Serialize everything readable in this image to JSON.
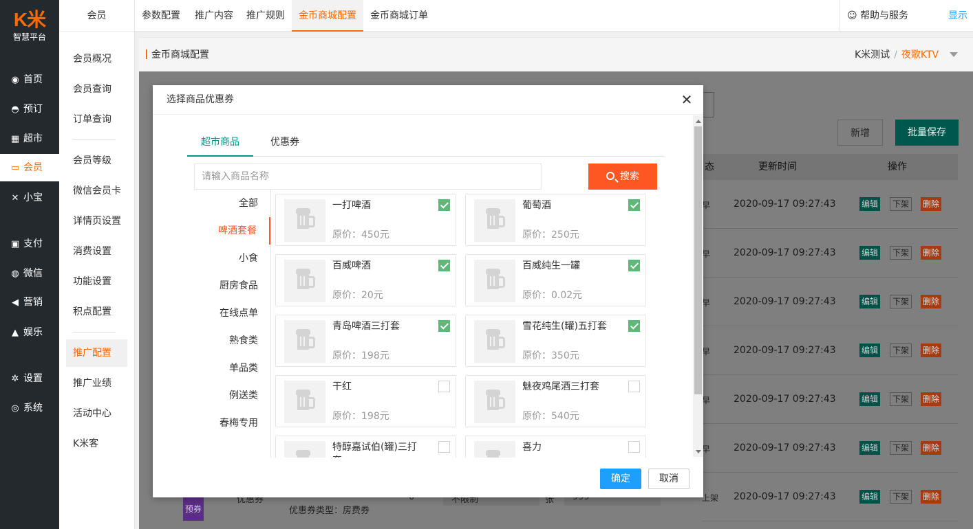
{
  "logo": {
    "mark": "K米",
    "subtitle": "智慧平台"
  },
  "sidebar": {
    "items": [
      {
        "label": "首页",
        "icon": "dashboard-icon",
        "glyph": "◉"
      },
      {
        "label": "预订",
        "icon": "bell-icon",
        "glyph": "◓"
      },
      {
        "label": "超市",
        "icon": "basket-icon",
        "glyph": "▦"
      },
      {
        "label": "会员",
        "icon": "card-icon",
        "glyph": "▭"
      },
      {
        "label": "小宝",
        "icon": "xiaobao-icon",
        "glyph": "✕"
      },
      {
        "label": "支付",
        "icon": "money-icon",
        "glyph": "▣"
      },
      {
        "label": "微信",
        "icon": "wechat-icon",
        "glyph": "◍"
      },
      {
        "label": "营销",
        "icon": "megaphone-icon",
        "glyph": "◀"
      },
      {
        "label": "娱乐",
        "icon": "lock-icon",
        "glyph": "▲"
      },
      {
        "label": "设置",
        "icon": "gears-icon",
        "glyph": "✲"
      },
      {
        "label": "系统",
        "icon": "compass-icon",
        "glyph": "◎"
      }
    ]
  },
  "subnav": {
    "header": "会员",
    "items": [
      "会员概况",
      "会员查询",
      "订单查询",
      "会员等级",
      "微信会员卡",
      "详情页设置",
      "消费设置",
      "功能设置",
      "积点配置",
      "推广配置",
      "推广业绩",
      "活动中心",
      "K米客"
    ]
  },
  "topbar": {
    "tabs": [
      "参数配置",
      "推广内容",
      "推广规则",
      "金币商城配置",
      "金币商城订单"
    ],
    "help": "帮助与服务",
    "show": "显示"
  },
  "breadcrumb": {
    "title": "金币商城配置",
    "store": "K米测试",
    "separator": "/",
    "branch": "夜歌KTV"
  },
  "page": {
    "add_button": "新增",
    "batch_save_button": "批量保存",
    "columns": {
      "status_partial": "态",
      "update_time": "更新时间",
      "actions": "操作"
    },
    "rows": [
      {
        "edge": "早",
        "time": "2020-09-17 09:27:43"
      },
      {
        "edge": "早",
        "time": "2020-09-17 09:27:43"
      },
      {
        "edge": "早",
        "time": "2020-09-17 09:27:43"
      },
      {
        "edge": "早",
        "time": "2020-09-17 09:27:43"
      },
      {
        "edge": "早",
        "time": "2020-09-17 09:27:43"
      },
      {
        "edge": "早",
        "time": "2020-09-17 09:27:43"
      },
      {
        "edge": "上架",
        "time": "2020-09-17 09:27:43"
      }
    ],
    "row_actions": {
      "edit": "编辑",
      "offline": "下架",
      "delete": "删除"
    },
    "under_modal": {
      "badge": "预券",
      "type_cell": "优惠券",
      "coupon_type": "优惠券类型：房费券",
      "count": "0",
      "limit": "不限制",
      "unit": "张",
      "price": "999"
    }
  },
  "modal": {
    "title": "选择商品优惠券",
    "tabs": [
      "超市商品",
      "优惠券"
    ],
    "search_placeholder": "请输入商品名称",
    "search_value": "",
    "search_button": "搜索",
    "categories": [
      "全部",
      "啤酒套餐",
      "小食",
      "厨房食品",
      "在线点单",
      "熟食类",
      "单品类",
      "例送类",
      "春梅专用"
    ],
    "active_category": "啤酒套餐",
    "products": [
      {
        "name": "一打啤酒",
        "price": "原价：450元",
        "checked": true
      },
      {
        "name": "葡萄酒",
        "price": "原价：250元",
        "checked": true
      },
      {
        "name": "百威啤酒",
        "price": "原价：20元",
        "checked": true
      },
      {
        "name": "百威纯生一罐",
        "price": "原价：0.02元",
        "checked": true
      },
      {
        "name": "青岛啤酒三打套",
        "price": "原价：198元",
        "checked": true
      },
      {
        "name": "雪花纯生(罐)五打套",
        "price": "原价：350元",
        "checked": true
      },
      {
        "name": "干红",
        "price": "原价：198元",
        "checked": false
      },
      {
        "name": "魅夜鸡尾酒三打套",
        "price": "原价：540元",
        "checked": false
      },
      {
        "name": "特醇嘉试伯(罐)三打套",
        "price": "",
        "checked": false
      },
      {
        "name": "喜力",
        "price": "",
        "checked": false
      }
    ],
    "confirm_button": "确定",
    "cancel_button": "取消"
  }
}
